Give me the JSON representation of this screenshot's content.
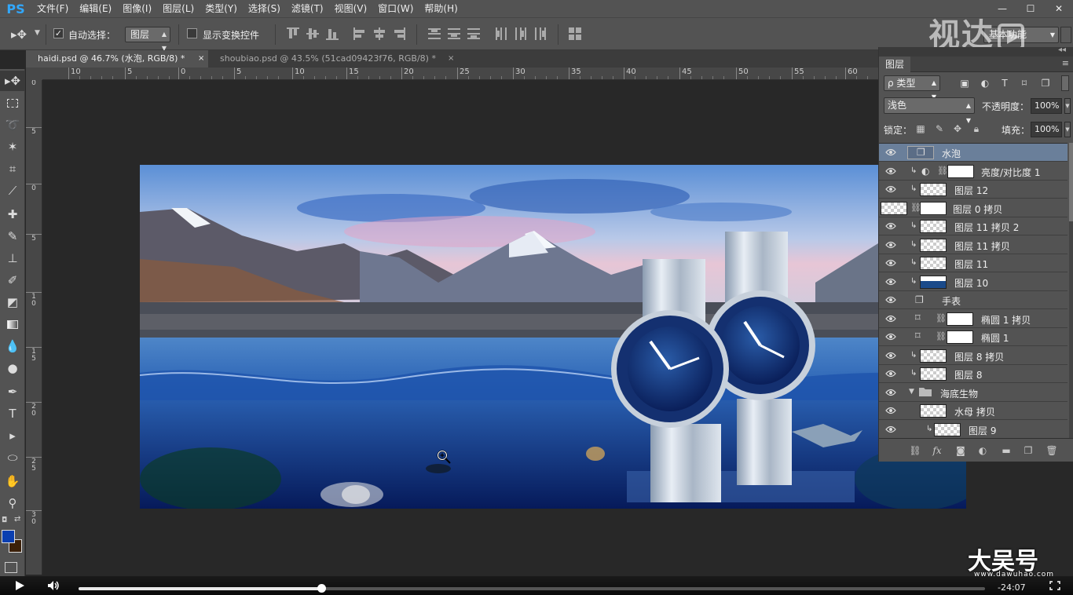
{
  "app": {
    "logo": "PS"
  },
  "menu": [
    "文件(F)",
    "编辑(E)",
    "图像(I)",
    "图层(L)",
    "类型(Y)",
    "选择(S)",
    "滤镜(T)",
    "视图(V)",
    "窗口(W)",
    "帮助(H)"
  ],
  "window_controls": {
    "minimize": "—",
    "maximize": "☐",
    "close": "✕"
  },
  "options_bar": {
    "tool_icon": "move-icon",
    "auto_select_checked": "✓",
    "auto_select_label": "自动选择：",
    "auto_select_value": "图层",
    "show_transform_label": "显示变换控件",
    "workspace_value": "基本功能"
  },
  "watermarks": {
    "top_right": "视达",
    "bottom_right": "大吴号",
    "bottom_right_url": "www.dawuhao.com"
  },
  "tabs": [
    {
      "label": "haidi.psd @ 46.7% (水泡, RGB/8) *",
      "close": "×",
      "active": true
    },
    {
      "label": "shoubiao.psd @ 43.5% (51cad09423f76, RGB/8) *",
      "close": "×",
      "active": false
    }
  ],
  "ruler_h": [
    "10",
    "5",
    "0",
    "5",
    "10",
    "15",
    "20",
    "25",
    "30",
    "35",
    "40",
    "45",
    "50",
    "55",
    "60"
  ],
  "ruler_v": [
    "0",
    "5",
    "0",
    "5",
    "1 0",
    "1 5",
    "2 0",
    "2 5",
    "3 0"
  ],
  "layers_panel": {
    "title": "图层",
    "menu_icon": "≡",
    "filter_label": "ρ 类型",
    "blend_mode": "浅色",
    "opacity_label": "不透明度：",
    "opacity": "100%",
    "lock_label": "锁定：",
    "fill_label": "填充：",
    "fill": "100%",
    "layers": [
      {
        "name": "水泡",
        "kind": "smart",
        "selected": true
      },
      {
        "name": "亮度/对比度 1",
        "kind": "adjustment",
        "clip": true
      },
      {
        "name": "图层 12",
        "kind": "pixel",
        "clip": true
      },
      {
        "name": "图层 0 拷贝",
        "kind": "pixel-mask"
      },
      {
        "name": "图层 11 拷贝 2",
        "kind": "pixel",
        "clip": true
      },
      {
        "name": "图层 11 拷贝",
        "kind": "pixel",
        "clip": true
      },
      {
        "name": "图层 11",
        "kind": "pixel",
        "clip": true
      },
      {
        "name": "图层 10",
        "kind": "pixel-img",
        "clip": true
      },
      {
        "name": "手表",
        "kind": "smart-only"
      },
      {
        "name": "椭圆 1 拷贝",
        "kind": "shape"
      },
      {
        "name": "椭圆 1",
        "kind": "shape"
      },
      {
        "name": "图层 8 拷贝",
        "kind": "pixel",
        "clip": true
      },
      {
        "name": "图层 8",
        "kind": "pixel",
        "clip": true
      },
      {
        "name": "海底生物",
        "kind": "group"
      },
      {
        "name": "水母 拷贝",
        "kind": "pixel-indent"
      },
      {
        "name": "图层 9",
        "kind": "pixel-indent2",
        "clip": true
      }
    ]
  },
  "video": {
    "progress": 0.268,
    "time_remaining": "-24:07"
  },
  "colors": {
    "foreground": "#0a3fb1",
    "background": "#3b200a",
    "selection": "#6a7f9a",
    "ps_blue": "#31a8ff"
  }
}
